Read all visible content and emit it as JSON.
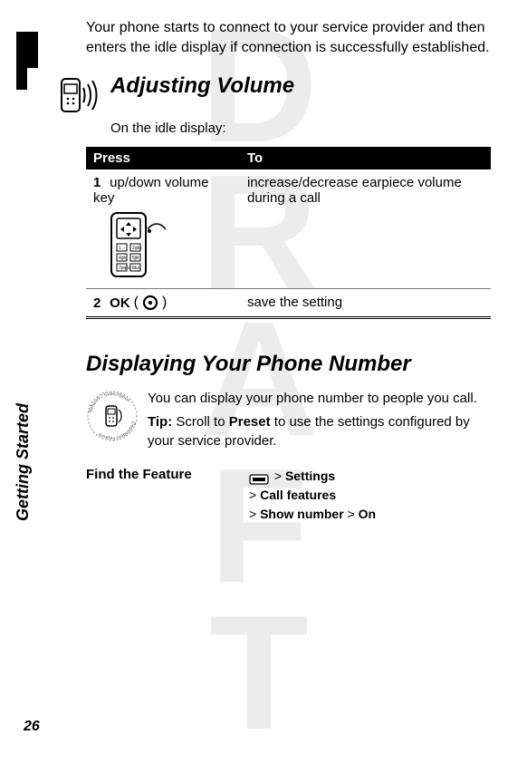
{
  "watermark": "DRAFT",
  "sidebar_label": "Getting Started",
  "intro": "Your phone starts to connect to your service provider and then enters the idle display if connection is successfully established.",
  "section1": {
    "heading": "Adjusting Volume",
    "subline": "On the idle display:"
  },
  "table": {
    "head_press": "Press",
    "head_to": "To",
    "rows": [
      {
        "num": "1",
        "press": "up/down volume key",
        "to": "increase/decrease earpiece volume during a call"
      },
      {
        "num": "2",
        "press_prefix": "OK",
        "press_paren_open": "(",
        "press_paren_close": ")",
        "to": "save the setting"
      }
    ]
  },
  "section2": {
    "heading": "Displaying Your Phone Number",
    "p1": "You can display your phone number to people you call.",
    "tip_label": "Tip:",
    "tip_rest": " Scroll to ",
    "tip_preset": "Preset",
    "tip_rest2": " to use the settings configured by your service provider."
  },
  "find_feature": {
    "label": "Find the Feature",
    "gt": ">",
    "l1": "Settings",
    "l2": "Call features",
    "l3a": "Show number",
    "l3b": "On"
  },
  "page_number": "26"
}
